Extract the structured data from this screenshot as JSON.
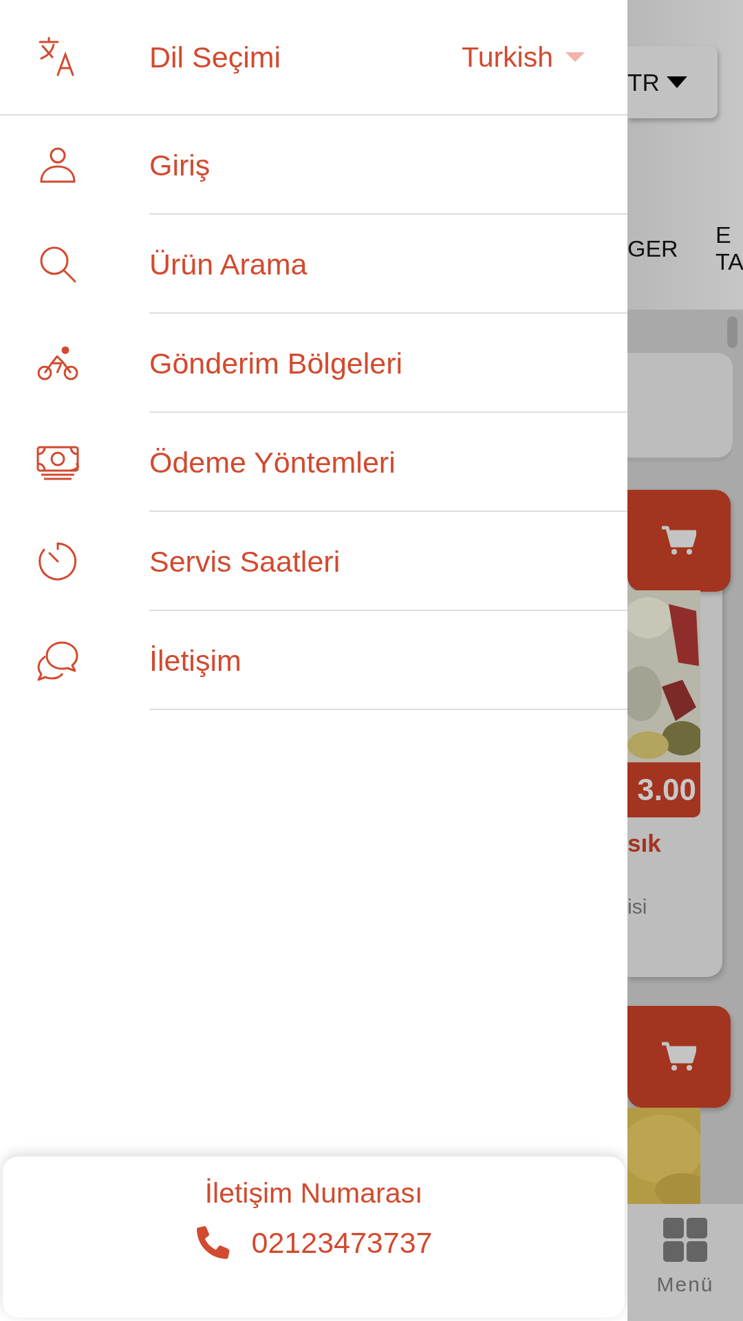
{
  "language_selector": {
    "label": "Dil Seçimi",
    "value": "Turkish"
  },
  "menu_items": [
    {
      "label": "Giriş",
      "kind": "login"
    },
    {
      "label": "Ürün Arama",
      "kind": "search"
    },
    {
      "label": "Gönderim Bölgeleri",
      "kind": "delivery"
    },
    {
      "label": "Ödeme Yöntemleri",
      "kind": "payment"
    },
    {
      "label": "Servis Saatleri",
      "kind": "hours"
    },
    {
      "label": "İletişim",
      "kind": "contact"
    }
  ],
  "contact_card": {
    "title": "İletişim Numarası",
    "phone": "02123473737"
  },
  "background_app": {
    "language_button": "TR",
    "category_tabs": [
      "GER",
      "E TA"
    ],
    "product": {
      "price": "3.00",
      "name": "sık",
      "description": "isi"
    },
    "bottom_nav": {
      "label": "Menü"
    }
  }
}
